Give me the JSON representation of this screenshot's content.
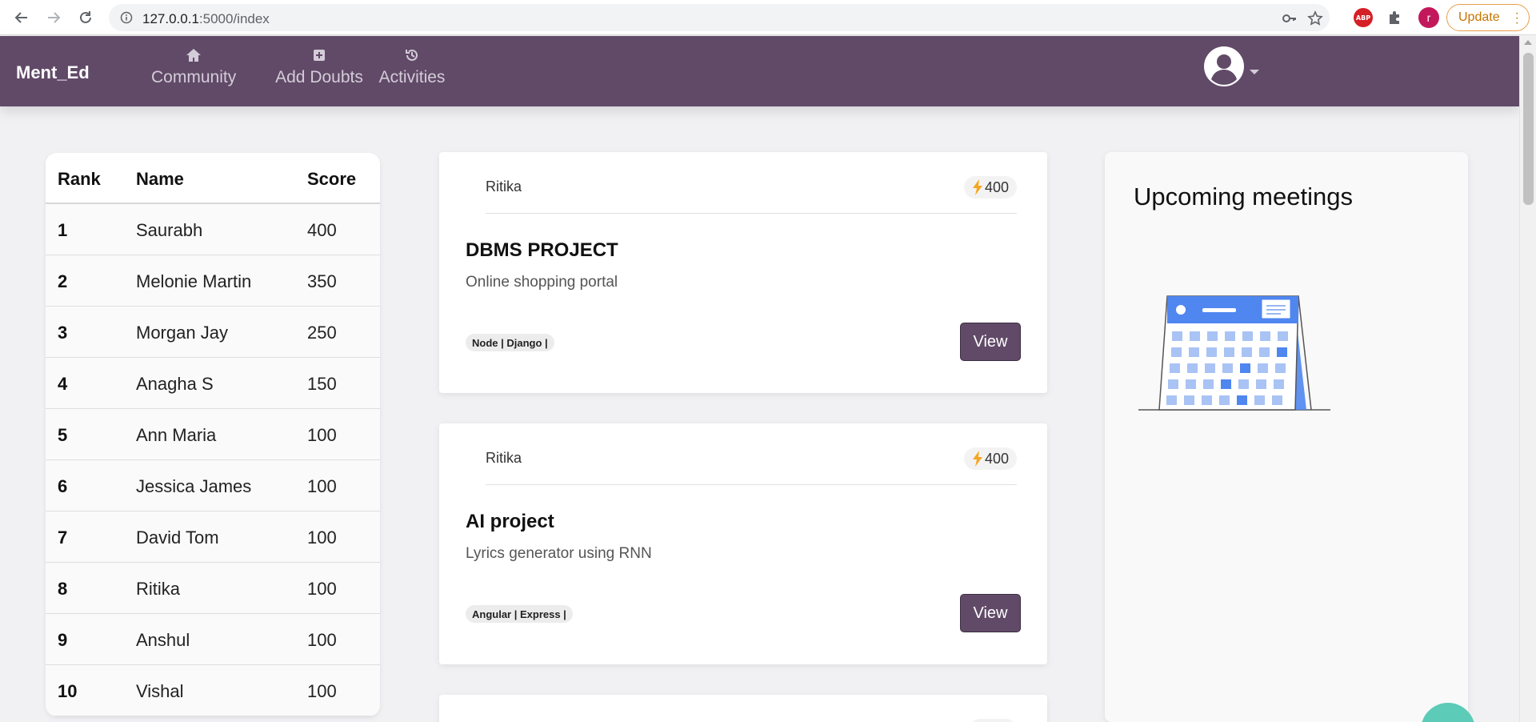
{
  "browser": {
    "url_host": "127.0.0.1",
    "url_path": ":5000/index",
    "update_label": "Update",
    "profile_initial": "r",
    "abp_label": "ABP"
  },
  "navbar": {
    "brand": "Ment_Ed",
    "items": [
      {
        "label": "Community",
        "icon": "home-icon"
      },
      {
        "label": "Add Doubts",
        "icon": "plus-square-icon"
      },
      {
        "label": "Activities",
        "icon": "history-icon"
      }
    ]
  },
  "leaderboard": {
    "headers": {
      "rank": "Rank",
      "name": "Name",
      "score": "Score"
    },
    "rows": [
      {
        "rank": "1",
        "name": "Saurabh",
        "score": "400"
      },
      {
        "rank": "2",
        "name": "Melonie Martin",
        "score": "350"
      },
      {
        "rank": "3",
        "name": "Morgan Jay",
        "score": "250"
      },
      {
        "rank": "4",
        "name": "Anagha S",
        "score": "150"
      },
      {
        "rank": "5",
        "name": "Ann Maria",
        "score": "100"
      },
      {
        "rank": "6",
        "name": "Jessica James",
        "score": "100"
      },
      {
        "rank": "7",
        "name": "David Tom",
        "score": "100"
      },
      {
        "rank": "8",
        "name": "Ritika",
        "score": "100"
      },
      {
        "rank": "9",
        "name": "Anshul",
        "score": "100"
      },
      {
        "rank": "10",
        "name": "Vishal",
        "score": "100"
      }
    ]
  },
  "cards": [
    {
      "author": "Ritika",
      "score": "400",
      "title": "DBMS PROJECT",
      "description": "Online shopping portal",
      "tags": "Node | Django |",
      "button": "View"
    },
    {
      "author": "Ritika",
      "score": "400",
      "title": "AI project",
      "description": "Lyrics generator using RNN",
      "tags": "Angular | Express |",
      "button": "View"
    }
  ],
  "meetings": {
    "title": "Upcoming meetings"
  },
  "colors": {
    "navbar": "#614a68",
    "accent_button": "#614a68",
    "bolt": "#f5a623",
    "calendar_blue": "#4f86f0"
  }
}
